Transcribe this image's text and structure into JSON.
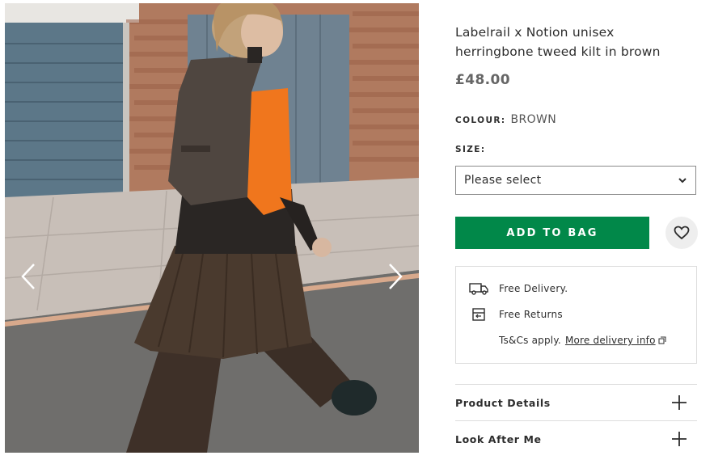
{
  "gallery": {
    "prev_icon": "chevron-left-icon",
    "next_icon": "chevron-right-icon"
  },
  "product": {
    "title_line1": "Labelrail x Notion unisex",
    "title_line2": "herringbone tweed kilt in brown",
    "price": "£48.00",
    "colour_label": "COLOUR:",
    "colour_value": "BROWN",
    "size_label": "SIZE:",
    "size_placeholder": "Please select"
  },
  "actions": {
    "add_to_bag": "ADD TO BAG",
    "save_icon": "heart-icon"
  },
  "delivery": {
    "free_delivery": "Free Delivery.",
    "free_returns": "Free Returns",
    "tsc_text": "Ts&Cs apply.",
    "more_info": "More delivery info"
  },
  "accordion": [
    {
      "title": "Product Details"
    },
    {
      "title": "Look After Me"
    }
  ],
  "colors": {
    "accent_green": "#018849",
    "text": "#2d2d2d",
    "price_grey": "#666666",
    "border": "#dddddd"
  }
}
